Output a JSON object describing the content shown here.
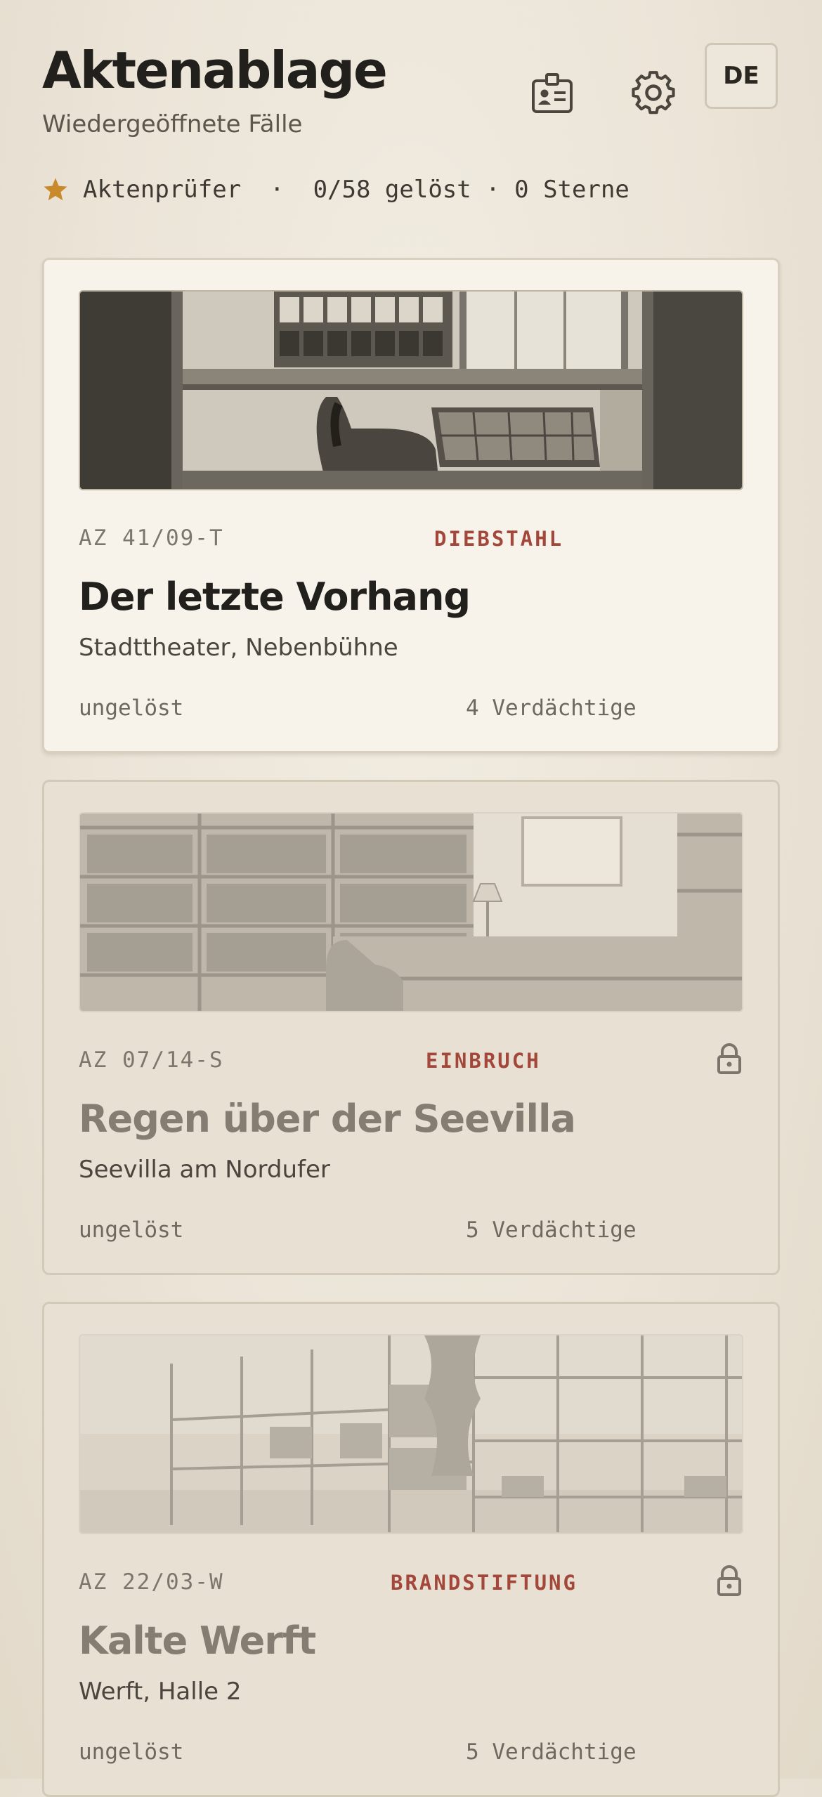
{
  "header": {
    "title": "Aktenablage",
    "subtitle": "Wiedergeöffnete Fälle",
    "language": "DE",
    "badge_icon": "id-badge-icon",
    "settings_icon": "gear-icon"
  },
  "stats": {
    "rank": "Aktenprüfer",
    "separator": "·",
    "progress": "0/58 gelöst · 0 Sterne",
    "solved": 0,
    "total": 58,
    "stars": 0,
    "star_color": "#c88a2a"
  },
  "cases": [
    {
      "number": "AZ 41/09-T",
      "category": "DIEBSTAHL",
      "title": "Der letzte Vorhang",
      "location": "Stadttheater, Nebenbühne",
      "status": "ungelöst",
      "suspects": "4 Verdächtige",
      "locked": false,
      "illustration": "backstage-office-sketch"
    },
    {
      "number": "AZ 07/14-S",
      "category": "EINBRUCH",
      "title": "Regen über der Seevilla",
      "location": "Seevilla am Nordufer",
      "status": "ungelöst",
      "suspects": "5 Verdächtige",
      "locked": true,
      "illustration": "library-room-sketch"
    },
    {
      "number": "AZ 22/03-W",
      "category": "BRANDSTIFTUNG",
      "title": "Kalte Werft",
      "location": "Werft, Halle 2",
      "status": "ungelöst",
      "suspects": "5 Verdächtige",
      "locked": true,
      "illustration": "warehouse-racks-sketch"
    }
  ],
  "colors": {
    "background": "#ebe4d7",
    "card_active": "#f7f3eb",
    "card_locked": "#e8e0d3",
    "category_red": "#a4473b"
  }
}
